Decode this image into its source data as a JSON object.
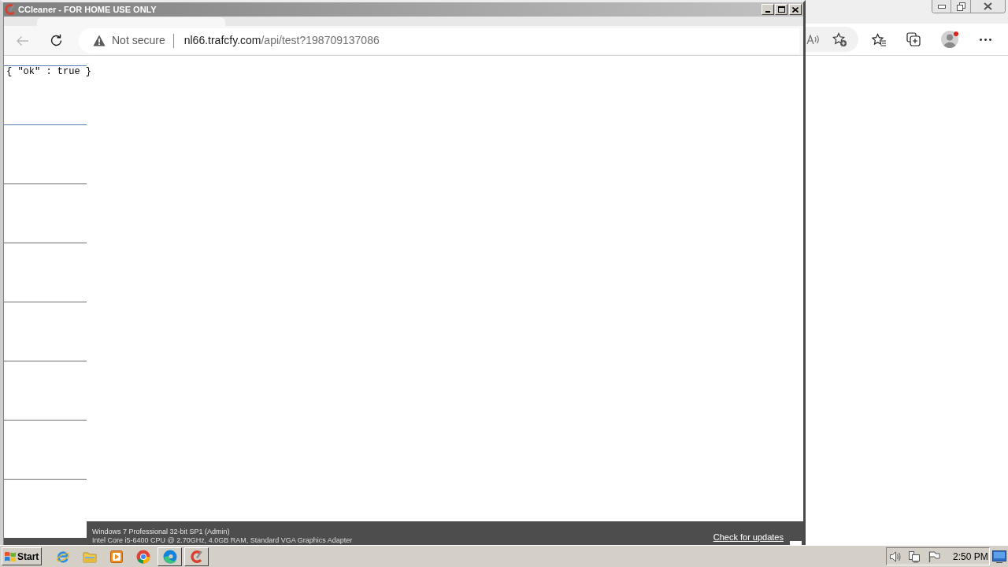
{
  "app_window": {
    "title": "CCleaner - FOR HOME USE ONLY"
  },
  "browser": {
    "back_disabled": true,
    "security_label": "Not secure",
    "url": {
      "host": "nl66.trafcfy.com",
      "path": "/api/test?198709137086"
    },
    "page_text": "{ \"ok\" : true }"
  },
  "sidebar": {
    "items": [
      {
        "selected": true
      },
      {
        "selected": false
      },
      {
        "selected": false
      },
      {
        "selected": false
      },
      {
        "selected": false
      },
      {
        "selected": false
      },
      {
        "selected": false
      }
    ]
  },
  "status_bar": {
    "system_lines": [
      "Windows 7 Professional 32-bit SP1 (Admin)",
      "Intel Core i5-6400 CPU @ 2.70GHz, 4.0GB RAM, Standard VGA Graphics Adapter"
    ],
    "link": "Check for updates"
  },
  "background_browser": {
    "profile_notification": true
  },
  "taskbar": {
    "start_label": "Start",
    "apps": [
      {
        "running": false
      },
      {
        "running": false
      },
      {
        "running": false
      },
      {
        "running": false
      },
      {
        "running": true
      },
      {
        "running": true
      }
    ],
    "clock": "2:50 PM"
  }
}
